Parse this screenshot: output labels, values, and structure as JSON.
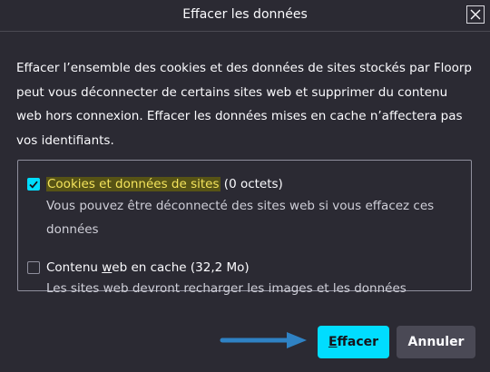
{
  "dialog": {
    "title": "Effacer les données",
    "close_icon": "close-icon"
  },
  "description": "Effacer l’ensemble des cookies et des données de sites stockés par Floorp peut vous déconnecter de certains sites web et supprimer du contenu web hors connexion. Effacer les données mises en cache n’affectera pas vos identifiants.",
  "options": {
    "cookies": {
      "checked": true,
      "label": "Cookies et données de sites",
      "size": "(0 octets)",
      "description": "Vous pouvez être déconnecté des sites web si vous effacez ces données"
    },
    "cache": {
      "checked": false,
      "label_before": "Contenu ",
      "label_access": "w",
      "label_after": "eb en cache",
      "size": "(32,2 Mo)",
      "description": "Les sites web devront recharger les images et les données"
    }
  },
  "buttons": {
    "clear_access": "E",
    "clear_rest": "ffacer",
    "cancel": "Annuler"
  },
  "colors": {
    "accent": "#00ddff",
    "background": "#2b2a33",
    "highlight_text": "#f4e45c",
    "arrow": "#2f82c4"
  }
}
